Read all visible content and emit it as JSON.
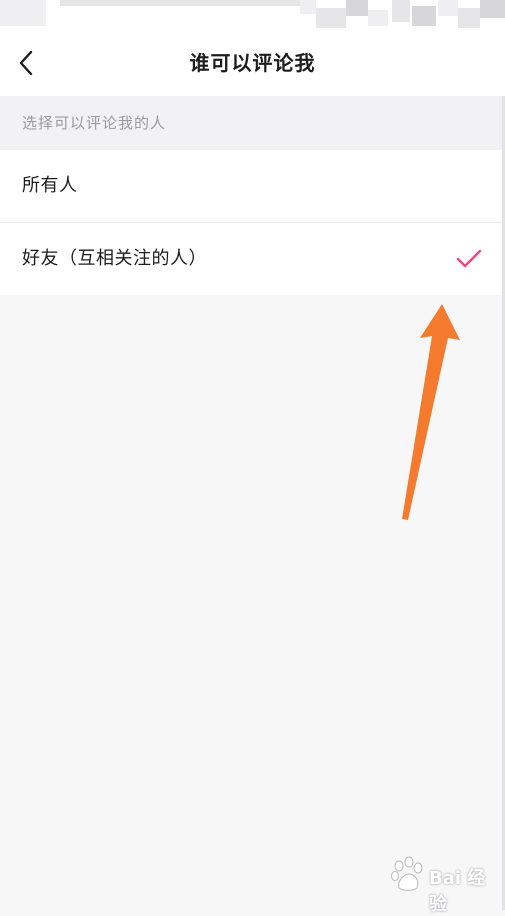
{
  "nav": {
    "title": "谁可以评论我",
    "back_icon": "chevron-left-icon"
  },
  "section": {
    "header": "选择可以评论我的人"
  },
  "options": [
    {
      "label": "所有人",
      "selected": false
    },
    {
      "label": "好友（互相关注的人）",
      "selected": true
    }
  ],
  "check_icon": "checkmark-icon",
  "colors": {
    "accent_check": "#f0457a",
    "annotation_arrow": "#f47a2e",
    "background": "#f7f7f8",
    "card": "#ffffff"
  },
  "watermark": {
    "text": "Bai 经验"
  }
}
